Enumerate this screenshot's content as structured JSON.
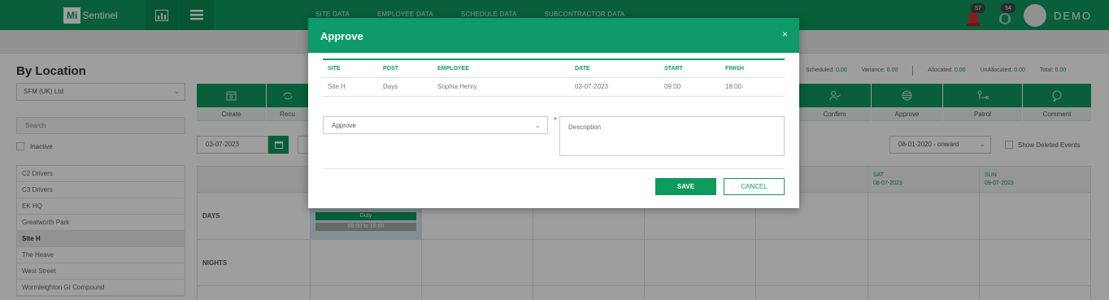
{
  "app": {
    "logo_mi": "Mi",
    "logo_name": "Sentinel",
    "user_name": "DEMO"
  },
  "topnav": [
    "SITE DATA",
    "EMPLOYEE DATA",
    "SCHEDULE DATA",
    "SUBCONTRACTOR DATA"
  ],
  "notifications": {
    "alerts": "57",
    "messages": "54"
  },
  "left": {
    "title": "By Location",
    "company": "SFM (UK) Ltd",
    "search_placeholder": "Search",
    "inactive_label": "Inactive",
    "locations": [
      "C2 Drivers",
      "C3 Drivers",
      "EK HQ",
      "Greatworth Park",
      "Site H",
      "The Heave",
      "West Street",
      "Wormleighton GI Compound"
    ],
    "active_location": "Site H"
  },
  "toolbar": {
    "items": [
      {
        "label": "Create",
        "icon": "calendar-add-icon"
      },
      {
        "label": "Recu",
        "icon": "recurring-icon"
      },
      {
        "label": "Confirm",
        "icon": "person-check-icon"
      },
      {
        "label": "Approve",
        "icon": "globe-icon"
      },
      {
        "label": "Patrol",
        "icon": "patrol-icon"
      },
      {
        "label": "Comment",
        "icon": "comment-icon"
      }
    ]
  },
  "date_filter": {
    "value": "03-07-2023"
  },
  "stats": {
    "scheduled_label": "Scheduled:",
    "scheduled": "0.00",
    "variance_label": "Variance:",
    "variance": "0.00",
    "allocated_label": "Allocated:",
    "allocated": "0.00",
    "unallocated_label": "UnAllocated:",
    "unallocated": "0.00",
    "total_label": "Total:",
    "total": "0.00"
  },
  "range_select": "08-01-2020 - onward",
  "show_deleted_label": "Show Deleted Events",
  "schedule": {
    "days": [
      {
        "name": "SAT",
        "date": "08-07-2023"
      },
      {
        "name": "SUN",
        "date": "09-07-2023"
      }
    ],
    "rows": [
      "DAYS",
      "NIGHTS"
    ],
    "duty": {
      "title": "Duty",
      "time": "09:00 to 18:00"
    }
  },
  "modal": {
    "title": "Approve",
    "close": "×",
    "table": {
      "headers": [
        "SITE",
        "POST",
        "EMPLOYEE",
        "DATE",
        "START",
        "FINISH"
      ],
      "row": [
        "Site H",
        "Days",
        "Sophia Henry",
        "03-07-2023",
        "09:00",
        "18:00"
      ]
    },
    "status_select": "Approve",
    "description_placeholder": "Description",
    "required_mark": "*",
    "save_label": "SAVE",
    "cancel_label": "CANCEL"
  }
}
